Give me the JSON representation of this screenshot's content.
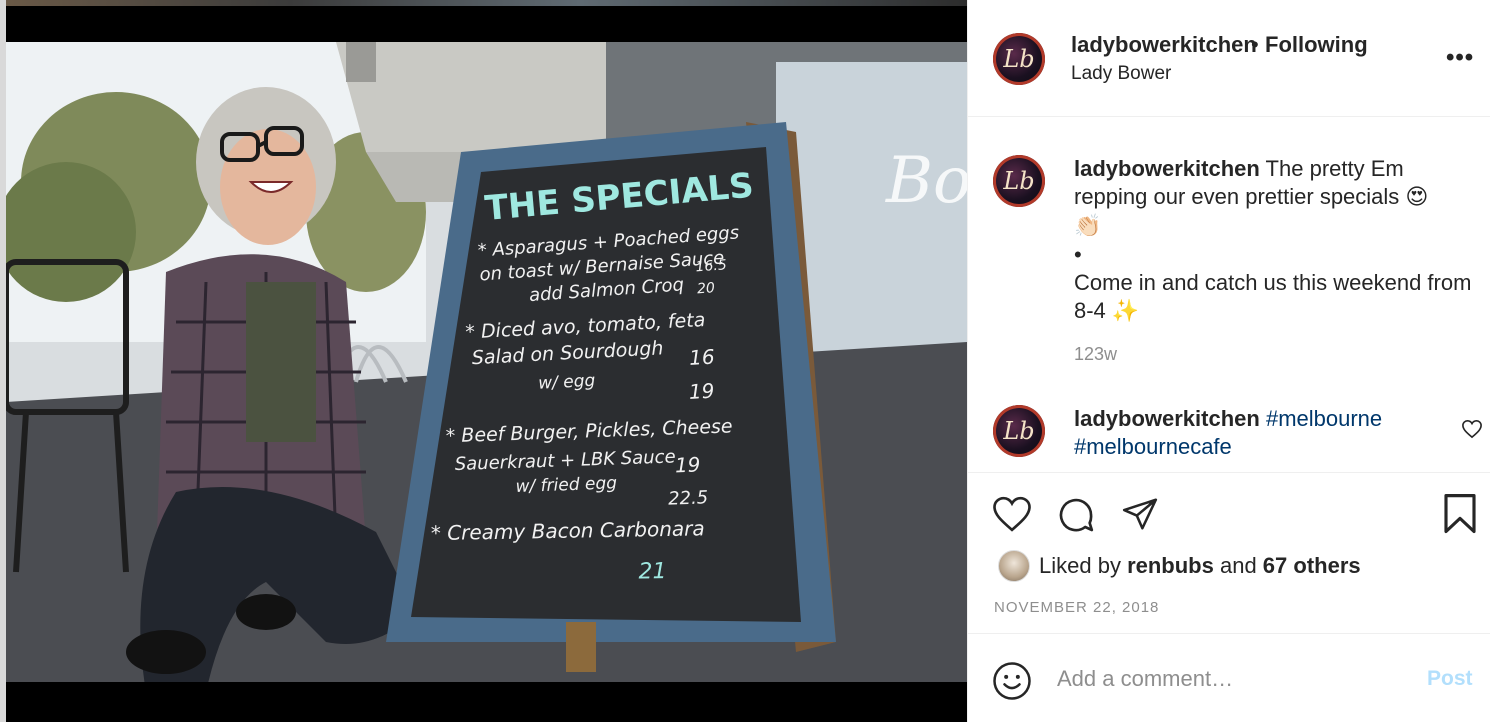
{
  "post": {
    "username": "ladybowerkitchen",
    "separator": "•",
    "follow_state": "Following",
    "location": "Lady Bower",
    "more_label": "•••",
    "avatar_monogram": "Lb"
  },
  "photo": {
    "board_title": "THE SPECIALS",
    "board_lines": [
      "* Asparagus + Poached eggs",
      "on toast w/ Bernaise Sauce",
      "add Salmon Croq",
      "16.5",
      "20",
      "* Diced avo, tomato, feta",
      "Salad on Sourdough",
      "w/ egg",
      "16",
      "19",
      "* Beef Burger, Pickles, Cheese",
      "Sauerkraut + LBK Sauce",
      "w/ fried egg",
      "19",
      "22.5",
      "* Creamy Bacon Carbonara",
      "21"
    ]
  },
  "caption": {
    "username": "ladybowerkitchen",
    "text_1": " The pretty Em repping our even prettier specials ",
    "emoji_1": "😍",
    "emoji_2": "👏🏻",
    "bullet": "•",
    "text_2": "Come in and catch us this weekend from 8-4 ",
    "emoji_3": "✨",
    "timestamp": "123w"
  },
  "comment_2": {
    "username": "ladybowerkitchen",
    "hashtag_1": "#melbourne",
    "hashtag_2": "#melbournecafe"
  },
  "engagement": {
    "liked_prefix": "Liked by ",
    "liked_user": "renbubs",
    "liked_and": " and ",
    "liked_others": "67 others",
    "date": "NOVEMBER 22, 2018"
  },
  "comment_box": {
    "placeholder": "Add a comment…",
    "post_label": "Post"
  },
  "colors": {
    "text": "#262626",
    "muted": "#8e8e8e",
    "hashtag": "#00376b",
    "post_disabled": "#b2dffc",
    "border": "#efefef"
  },
  "icons": [
    "heart-icon",
    "comment-icon",
    "share-icon",
    "bookmark-icon",
    "emoji-icon",
    "more-icon",
    "small-heart-icon"
  ]
}
